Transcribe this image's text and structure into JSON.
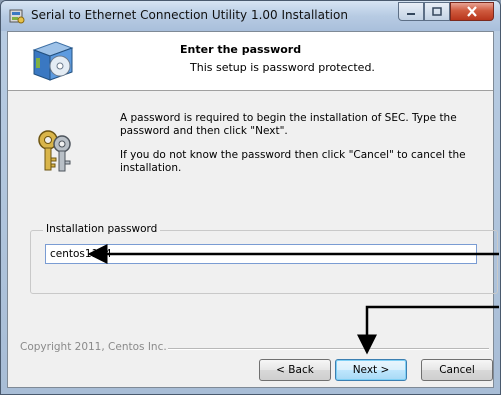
{
  "window": {
    "title": "Serial to Ethernet Connection Utility 1.00 Installation"
  },
  "header": {
    "title": "Enter the password",
    "subtitle": "This setup is password protected."
  },
  "body": {
    "line1": "A password is required to begin the installation of SEC. Type the password and then click \"Next\".",
    "line2": "If you do not know the password then click \"Cancel\" to cancel the installation."
  },
  "password": {
    "label": "Installation password",
    "value": "centos1104"
  },
  "footer": {
    "copyright": "Copyright 2011, Centos Inc."
  },
  "buttons": {
    "back": "< Back",
    "next": "Next >",
    "cancel": "Cancel"
  },
  "icons": {
    "title": "installer-icon",
    "header": "cd-box-icon",
    "body": "keys-icon"
  },
  "colors": {
    "annotation_arrow": "#000000",
    "default_button_border": "#3c7fb1"
  }
}
